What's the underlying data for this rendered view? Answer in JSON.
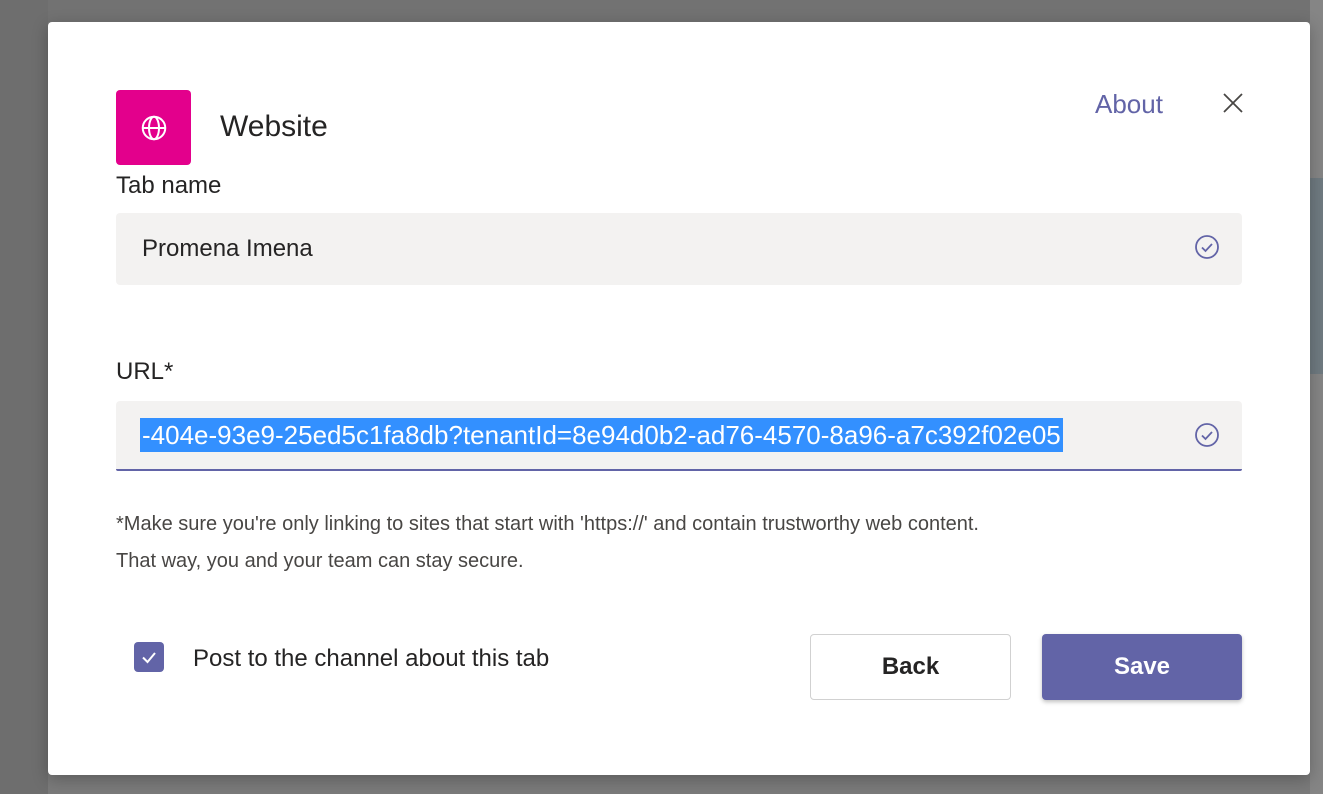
{
  "dialog": {
    "title": "Website",
    "app_icon": "globe-icon",
    "app_icon_color": "#e3008c",
    "about_label": "About",
    "close_icon": "close-icon"
  },
  "tab_name": {
    "label": "Tab name",
    "value": "Promena Imena",
    "status_icon": "check-circle-icon"
  },
  "url": {
    "label": "URL*",
    "value": "-404e-93e9-25ed5c1fa8db?tenantId=8e94d0b2-ad76-4570-8a96-a7c392f02e05",
    "selected": true,
    "status_icon": "check-circle-icon"
  },
  "hint": {
    "line1": "*Make sure you're only linking to sites that start with 'https://' and contain trustworthy web content.",
    "line2": "That way, you and your team can stay secure."
  },
  "post_to_channel": {
    "checked": true,
    "label": "Post to the channel about this tab"
  },
  "buttons": {
    "back_label": "Back",
    "save_label": "Save"
  },
  "colors": {
    "accent": "#6264a7",
    "selection": "#3390ff",
    "field_bg": "#f3f2f1"
  }
}
